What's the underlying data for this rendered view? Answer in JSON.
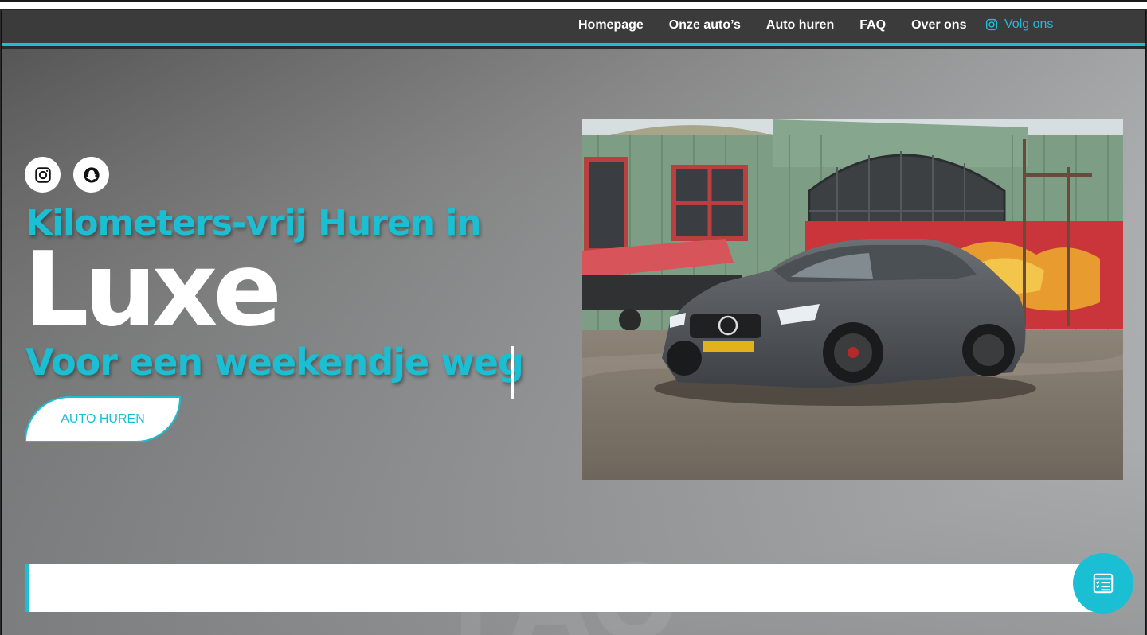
{
  "nav": {
    "items": [
      {
        "label": "Homepage"
      },
      {
        "label": "Onze auto’s"
      },
      {
        "label": "Auto huren"
      },
      {
        "label": "FAQ"
      },
      {
        "label": "Over ons"
      }
    ],
    "follow_label": "Volg ons",
    "follow_icon": "instagram-icon"
  },
  "hero": {
    "social": [
      {
        "icon": "instagram-icon"
      },
      {
        "icon": "snapchat-icon"
      }
    ],
    "line1": "Kilometers-vrij Huren in",
    "big_word": "Luxe",
    "line3": "Voor een weekendje weg",
    "cta_label": "AUTO HUREN"
  },
  "section_watermark": "FAQ",
  "fab_icon": "checklist-icon",
  "colors": {
    "accent": "#1bbfd3",
    "nav_bg": "#3b3b3b",
    "text_light": "#ffffff"
  }
}
